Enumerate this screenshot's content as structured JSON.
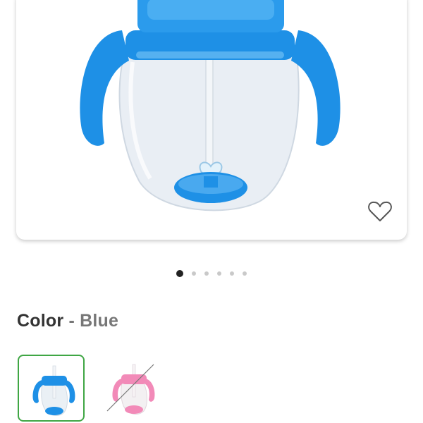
{
  "product": {
    "carousel": {
      "total_images": 6,
      "active_index": 0
    },
    "favorite_icon": "heart-outline-icon"
  },
  "color_selector": {
    "label": "Color",
    "separator": "-",
    "selected_value": "Blue",
    "swatches": [
      {
        "color": "#1e90e6",
        "selected": true,
        "available": true
      },
      {
        "color": "#f28ab8",
        "selected": false,
        "available": false
      }
    ]
  },
  "colors": {
    "accent_selected": "#3fa644",
    "product_blue": "#1e90e6"
  }
}
